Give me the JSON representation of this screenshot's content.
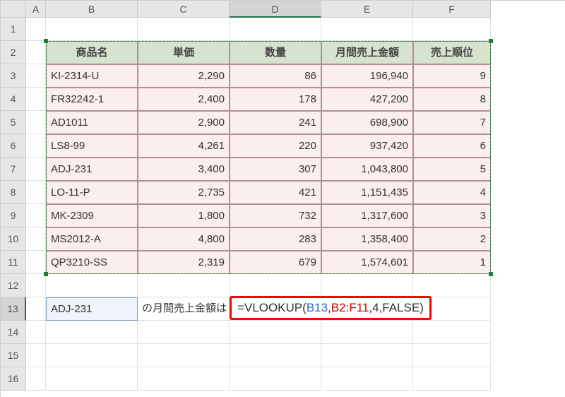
{
  "columns": [
    "A",
    "B",
    "C",
    "D",
    "E",
    "F"
  ],
  "rowCount": 16,
  "activeColumn": "D",
  "activeRow": 13,
  "table": {
    "headers": {
      "B": "商品名",
      "C": "単価",
      "D": "数量",
      "E": "月間売上金額",
      "F": "売上順位"
    },
    "rows": [
      {
        "name": "KI-2314-U",
        "price": "2,290",
        "qty": "86",
        "sales": "196,940",
        "rank": "9"
      },
      {
        "name": "FR32242-1",
        "price": "2,400",
        "qty": "178",
        "sales": "427,200",
        "rank": "8"
      },
      {
        "name": "AD1011",
        "price": "2,900",
        "qty": "241",
        "sales": "698,900",
        "rank": "7"
      },
      {
        "name": "LS8-99",
        "price": "4,261",
        "qty": "220",
        "sales": "937,420",
        "rank": "6"
      },
      {
        "name": "ADJ-231",
        "price": "3,400",
        "qty": "307",
        "sales": "1,043,800",
        "rank": "5"
      },
      {
        "name": "LO-11-P",
        "price": "2,735",
        "qty": "421",
        "sales": "1,151,435",
        "rank": "4"
      },
      {
        "name": "MK-2309",
        "price": "1,800",
        "qty": "732",
        "sales": "1,317,600",
        "rank": "3"
      },
      {
        "name": "MS2012-A",
        "price": "4,800",
        "qty": "283",
        "sales": "1,358,400",
        "rank": "2"
      },
      {
        "name": "QP3210-SS",
        "price": "2,319",
        "qty": "679",
        "sales": "1,574,601",
        "rank": "1"
      }
    ]
  },
  "lookup": {
    "value": "ADJ-231",
    "label": "の月間売上金額は"
  },
  "formula": {
    "eq": "=",
    "fn": "VLOOKUP",
    "open": "(",
    "ref1": "B13",
    "c1": ",",
    "ref2": "B2:F11",
    "c2": ",",
    "arg3": "4",
    "c3": ",",
    "arg4": "FALSE",
    "close": ")"
  },
  "chart_data": {
    "type": "table",
    "title": "",
    "columns": [
      "商品名",
      "単価",
      "数量",
      "月間売上金額",
      "売上順位"
    ],
    "rows": [
      [
        "KI-2314-U",
        2290,
        86,
        196940,
        9
      ],
      [
        "FR32242-1",
        2400,
        178,
        427200,
        8
      ],
      [
        "AD1011",
        2900,
        241,
        698900,
        7
      ],
      [
        "LS8-99",
        4261,
        220,
        937420,
        6
      ],
      [
        "ADJ-231",
        3400,
        307,
        1043800,
        5
      ],
      [
        "LO-11-P",
        2735,
        421,
        1151435,
        4
      ],
      [
        "MK-2309",
        1800,
        732,
        1317600,
        3
      ],
      [
        "MS2012-A",
        4800,
        283,
        1358400,
        2
      ],
      [
        "QP3210-SS",
        2319,
        679,
        1574601,
        1
      ]
    ]
  }
}
